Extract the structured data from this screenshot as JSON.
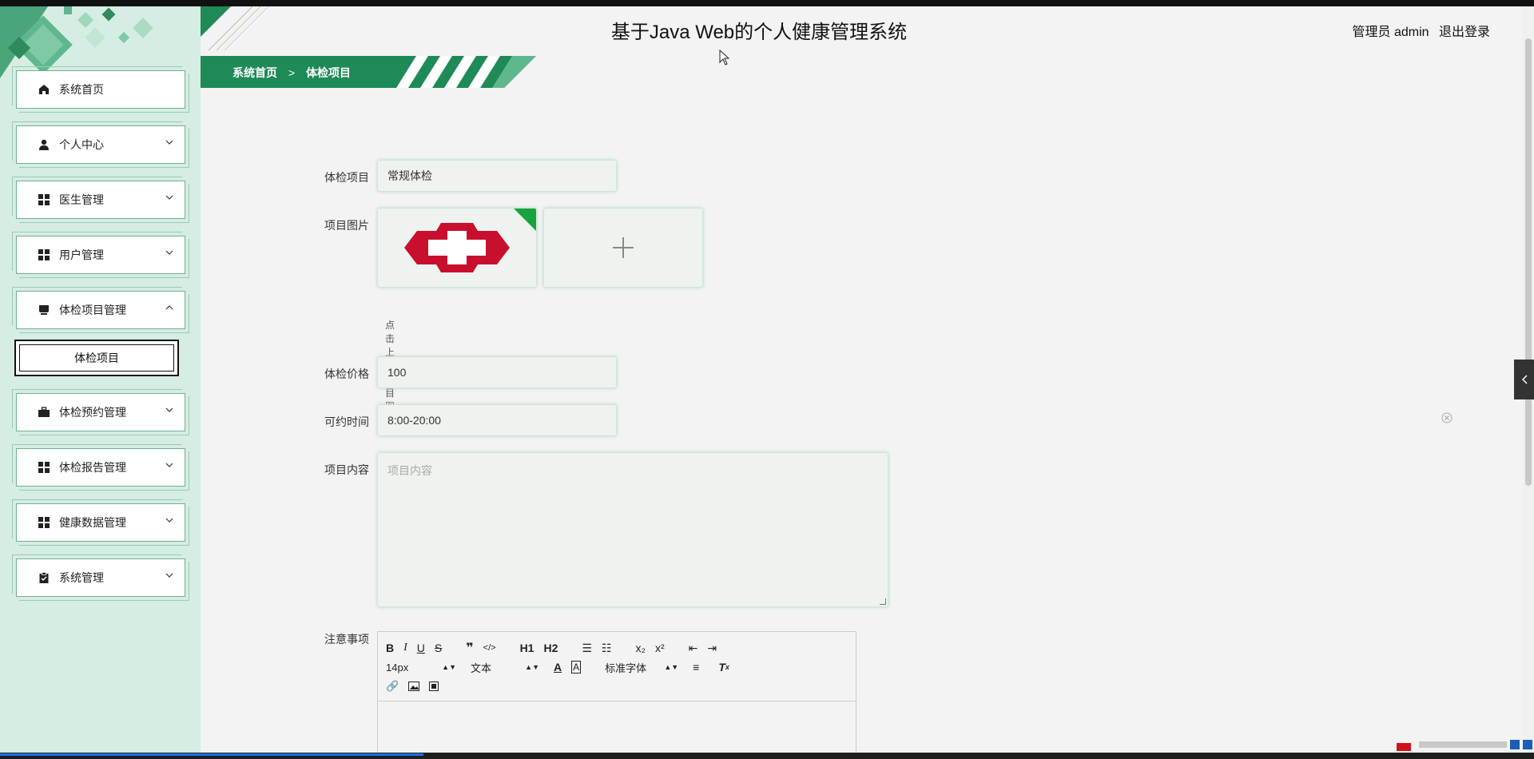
{
  "header": {
    "title": "基于Java Web的个人健康管理系统",
    "user_role": "管理员 admin",
    "logout": "退出登录"
  },
  "breadcrumb": {
    "home": "系统首页",
    "separator": ">",
    "current": "体检项目"
  },
  "sidebar": {
    "items": [
      {
        "label": "系统首页",
        "icon": "home-icon"
      },
      {
        "label": "个人中心",
        "icon": "person-icon"
      },
      {
        "label": "医生管理",
        "icon": "grid-icon"
      },
      {
        "label": "用户管理",
        "icon": "grid-icon"
      },
      {
        "label": "体检项目管理",
        "icon": "storefront-icon",
        "expanded": true
      },
      {
        "label": "体检预约管理",
        "icon": "briefcase-icon"
      },
      {
        "label": "体检报告管理",
        "icon": "grid-icon"
      },
      {
        "label": "健康数据管理",
        "icon": "grid-icon"
      },
      {
        "label": "系统管理",
        "icon": "clipboard-icon"
      }
    ],
    "submenu": {
      "label": "体检项目"
    }
  },
  "form": {
    "project_label": "体检项目",
    "project_value": "常规体检",
    "image_label": "项目图片",
    "upload_hint": "点击上传项目图片",
    "price_label": "体检价格",
    "price_value": "100",
    "time_label": "可约时间",
    "time_value": "8:00-20:00",
    "content_label": "项目内容",
    "content_placeholder": "项目内容",
    "notes_label": "注意事项"
  },
  "editor": {
    "font_size": "14px",
    "text_style": "文本",
    "font_family": "标准字体",
    "buttons_row1": [
      "B",
      "I",
      "U",
      "S",
      "quote-icon",
      "code-icon",
      "H1",
      "H2",
      "ordered-list-icon",
      "bullet-list-icon",
      "subscript-icon",
      "superscript-icon",
      "outdent-icon",
      "indent-icon"
    ],
    "buttons_row3": [
      "link-icon",
      "image-icon",
      "video-icon"
    ]
  },
  "colors": {
    "sidebar_bg": "#d5ede2",
    "accent_green": "#1e8a57",
    "page_bg": "#f3f3f3"
  }
}
